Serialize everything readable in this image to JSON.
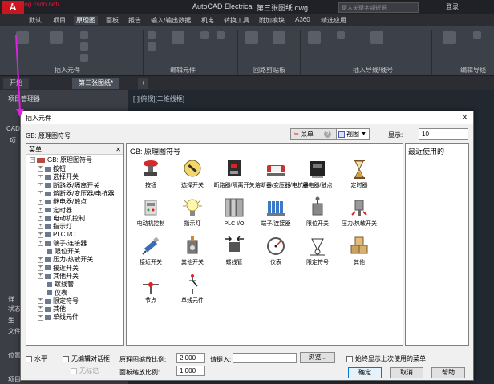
{
  "app": {
    "logo": "A",
    "watermark": "http://blog.csdn.net/...",
    "title": "AutoCAD Electrical",
    "document": "第三张图纸.dwg",
    "search_placeholder": "键入关键字或短语",
    "login": "登录"
  },
  "ribbon_tabs": [
    "默认",
    "项目",
    "原理图",
    "面板",
    "报告",
    "输入/输出数据",
    "机电",
    "转换工具",
    "附加模块",
    "A360",
    "精选应用"
  ],
  "ribbon_active_tab": "原理图",
  "ribbon_panels": [
    "插入元件",
    "编辑元件",
    "回路剪贴板",
    "插入导线/线号",
    "编辑导线"
  ],
  "doc_tabs": [
    "开始",
    "第三张图纸*"
  ],
  "side_panel": {
    "title": "项目管理器",
    "labels": [
      "CAD",
      "项",
      "详",
      "状态",
      "生",
      "文件",
      "位置",
      "项目"
    ]
  },
  "viewport_label": "[-][俯视][二维线框]",
  "dialog": {
    "title": "插入元件",
    "gb_label": "GB: 原理图符号",
    "menu_button": "菜单",
    "view_button": "视图",
    "display_label": "显示:",
    "display_value": "10",
    "tree_header": "菜单",
    "tree_root": "GB: 原理图符号",
    "tree_items": [
      "按钮",
      "选择开关",
      "断路器/隔离开关",
      "熔断器/变压器/电抗器",
      "继电器/触点",
      "定时器",
      "电动机控制",
      "指示灯",
      "PLC I/O",
      "端子/连接器",
      "限位开关",
      "压力/热敏开关",
      "接近开关",
      "其他开关",
      "螺线管",
      "仪表",
      "限定符号",
      "其他",
      "单线元件"
    ],
    "grid_header": "GB: 原理图符号",
    "symbols": [
      {
        "label": "按钮",
        "icon": "pushbutton-icon"
      },
      {
        "label": "选择开关",
        "icon": "selector-switch-icon"
      },
      {
        "label": "断路器/隔离开关",
        "icon": "breaker-icon"
      },
      {
        "label": "熔断器/变压器/电抗器",
        "icon": "fuse-icon"
      },
      {
        "label": "继电器/触点",
        "icon": "relay-icon"
      },
      {
        "label": "定时器",
        "icon": "hourglass-icon"
      },
      {
        "label": "电动机控制",
        "icon": "motor-control-icon"
      },
      {
        "label": "指示灯",
        "icon": "pilot-light-icon"
      },
      {
        "label": "PLC I/O",
        "icon": "plc-icon"
      },
      {
        "label": "端子/连接器",
        "icon": "terminal-icon"
      },
      {
        "label": "限位开关",
        "icon": "limit-switch-icon"
      },
      {
        "label": "压力/热敏开关",
        "icon": "pressure-switch-icon"
      },
      {
        "label": "接近开关",
        "icon": "proximity-switch-icon"
      },
      {
        "label": "其他开关",
        "icon": "other-switch-icon"
      },
      {
        "label": "螺线管",
        "icon": "solenoid-icon"
      },
      {
        "label": "仪表",
        "icon": "gauge-icon"
      },
      {
        "label": "限定符号",
        "icon": "qualifier-icon"
      },
      {
        "label": "其他",
        "icon": "misc-boxes-icon"
      },
      {
        "label": "节点",
        "icon": "node-icon"
      },
      {
        "label": "单线元件",
        "icon": "single-line-icon"
      }
    ],
    "recent_header": "最近使用的",
    "horizontal_label": "水平",
    "no_edit_dialog_label": "无编辑对话框",
    "no_tag_label": "无标记",
    "schematic_scale_label": "原理图缩放比例:",
    "schematic_scale_value": "2.000",
    "panel_scale_label": "面板缩放比例:",
    "panel_scale_value": "1.000",
    "type_label": "请键入:",
    "browse_button": "浏览...",
    "always_show_last_label": "始终显示上次使用的菜单",
    "ok_button": "确定",
    "cancel_button": "取消",
    "help_button": "帮助"
  },
  "colors": {
    "cad_bg": "#2b2d33",
    "ribbon_bg": "#3c4048",
    "canvas_bg": "#212830",
    "dialog_bg": "#f0f0f0",
    "arrow": "#e020e0"
  }
}
